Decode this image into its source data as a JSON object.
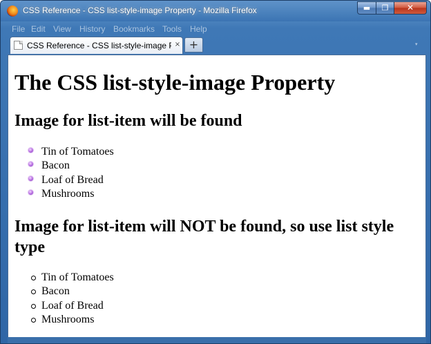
{
  "window": {
    "title": "CSS Reference - CSS list-style-image Property - Mozilla Firefox",
    "app_icon": "firefox-icon",
    "controls": {
      "minimize": "▬",
      "maximize": "❐",
      "close": "✕"
    }
  },
  "menubar": {
    "items": [
      {
        "label": "File"
      },
      {
        "label": "Edit"
      },
      {
        "label": "View"
      },
      {
        "label": "History"
      },
      {
        "label": "Bookmarks"
      },
      {
        "label": "Tools"
      },
      {
        "label": "Help"
      }
    ]
  },
  "tabs": {
    "active": {
      "label": "CSS Reference - CSS list-style-image Pro...",
      "close": "×"
    },
    "new_tab": "+",
    "list_all": "▾"
  },
  "page": {
    "heading": "The CSS list-style-image Property",
    "section1": {
      "heading": "Image for list-item will be found",
      "items": [
        "Tin of Tomatoes",
        "Bacon",
        "Loaf of Bread",
        "Mushrooms"
      ]
    },
    "section2": {
      "heading": "Image for list-item will NOT be found, so use list style type",
      "items": [
        "Tin of Tomatoes",
        "Bacon",
        "Loaf of Bread",
        "Mushrooms"
      ]
    }
  },
  "colors": {
    "frame": "#3f78b6",
    "bullet_image": "#b56be0",
    "close_button": "#c94a2e"
  }
}
